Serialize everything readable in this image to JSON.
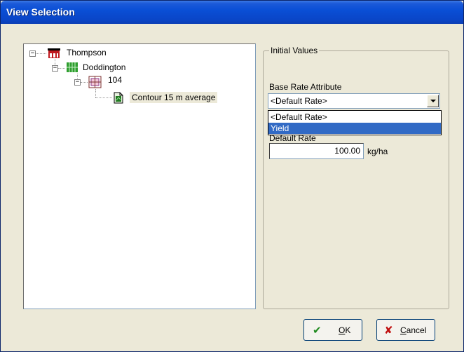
{
  "window": {
    "title": "View Selection"
  },
  "tree": {
    "nodes": [
      {
        "label": "Thompson",
        "icon": "farm-icon",
        "expander": "−"
      },
      {
        "label": "Doddington",
        "icon": "field-icon",
        "expander": "−"
      },
      {
        "label": "104",
        "icon": "paddock-grid-icon",
        "expander": "−"
      },
      {
        "label": "Contour 15 m average",
        "icon": "map-document-icon",
        "selected": true
      }
    ]
  },
  "initial_values": {
    "group_title": "Initial Values",
    "base_rate_label": "Base Rate Attribute",
    "base_rate_selected": "<Default Rate>",
    "dropdown_options": [
      "<Default Rate>",
      "Yield"
    ],
    "highlighted_option": "Yield",
    "obscured_label_fragment": "Default Rate",
    "rate_value": "100.00",
    "rate_unit": "kg/ha"
  },
  "buttons": {
    "ok_prefix": "",
    "ok_mnemonic": "O",
    "ok_rest": "K",
    "cancel_mnemonic": "C",
    "cancel_rest": "ancel"
  },
  "colors": {
    "title_bar": "#0a4fd6",
    "selection": "#316ac5",
    "ok_check": "#1e8a1e",
    "cancel_x": "#c01010"
  }
}
